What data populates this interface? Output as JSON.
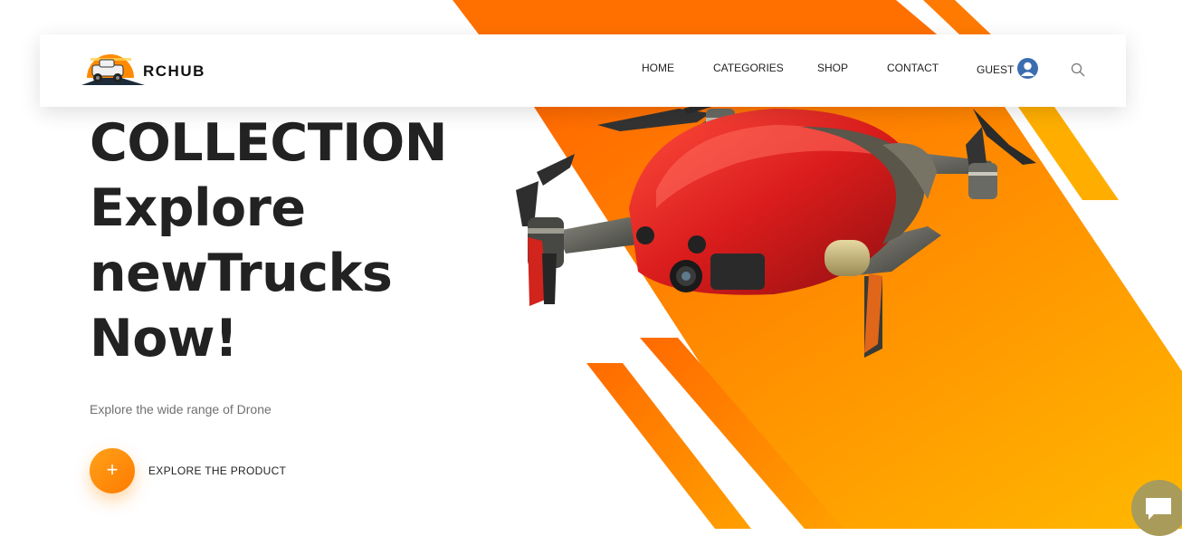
{
  "brand": {
    "logo_text": "RCHUB"
  },
  "nav": {
    "items": [
      {
        "label": "HOME"
      },
      {
        "label": "CATEGORIES"
      },
      {
        "label": "SHOP"
      },
      {
        "label": "CONTACT"
      }
    ],
    "guest_label": "GUEST",
    "icons": {
      "user": "user-avatar-icon",
      "search": "search-icon"
    }
  },
  "hero": {
    "title_lines": [
      "COLLECTION",
      "Explore",
      "newTrucks",
      "Now!"
    ],
    "subtitle": "Explore the wide range of Drone",
    "cta_icon": "+",
    "cta_label": "EXPLORE THE PRODUCT",
    "image": "drone-image"
  },
  "chat": {
    "icon": "chat-bubble-icon"
  },
  "colors": {
    "accent_orange": "#ff6d00",
    "accent_yellow": "#ffb300",
    "text_dark": "#222222",
    "text_muted": "#707070",
    "avatar_blue": "#3b6eb0"
  }
}
